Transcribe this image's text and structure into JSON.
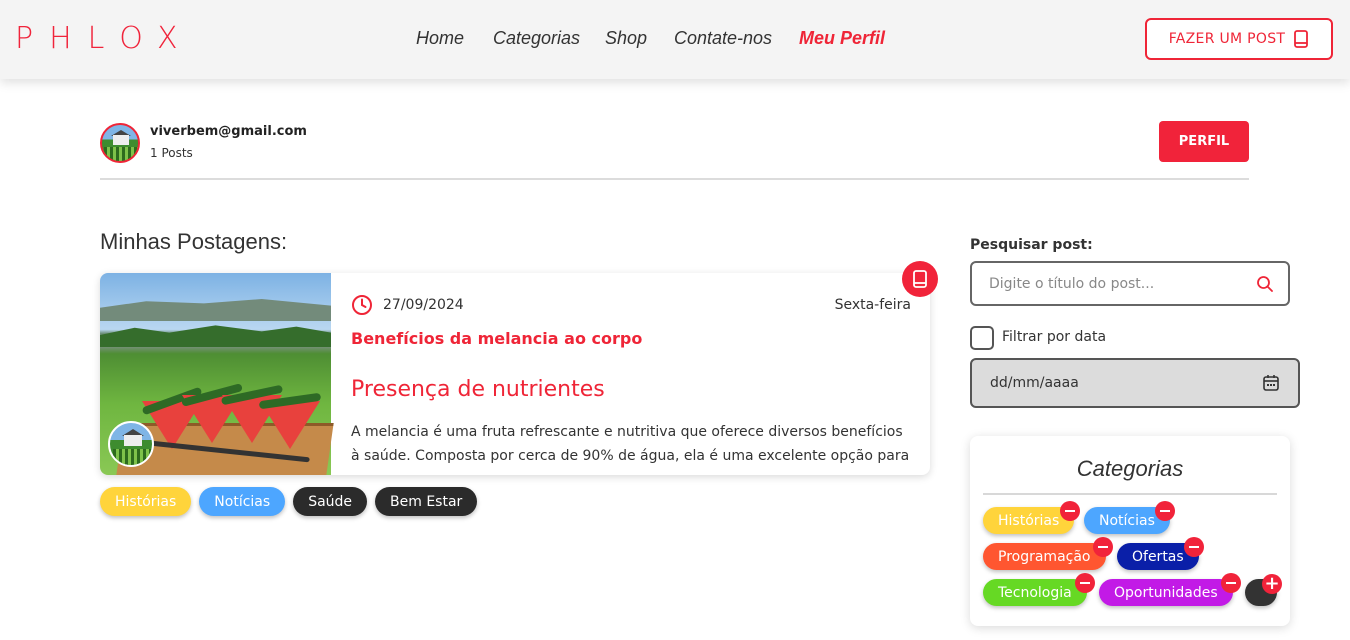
{
  "header": {
    "logo": "PHLOX",
    "nav": [
      "Home",
      "Categorias",
      "Shop",
      "Contate-nos",
      "Meu Perfil"
    ],
    "post_button": "FAZER UM POST"
  },
  "profile": {
    "email": "viverbem@gmail.com",
    "posts_count": "1 Posts",
    "profile_button": "PERFIL"
  },
  "posts": {
    "section_title": "Minhas Postagens:",
    "items": [
      {
        "date": "27/09/2024",
        "weekday": "Sexta-feira",
        "title": "Benefícios da melancia ao corpo",
        "subtitle": "Presença de nutrientes",
        "excerpt": "A melancia é uma fruta refrescante e nutritiva que oferece diversos benefícios à saúde. Composta por cerca de 90% de água, ela é uma excelente opção para",
        "tags": [
          {
            "label": "Histórias",
            "color": "#ffd43b",
            "text": "#ffffff"
          },
          {
            "label": "Notícias",
            "color": "#4da6ff",
            "text": "#ffffff"
          },
          {
            "label": "Saúde",
            "color": "#2b2b2b",
            "text": "#ffffff"
          },
          {
            "label": "Bem Estar",
            "color": "#2b2b2b",
            "text": "#ffffff"
          }
        ]
      }
    ]
  },
  "sidebar": {
    "search_label": "Pesquisar post:",
    "search_placeholder": "Digite o título do post...",
    "filter_label": "Filtrar por data",
    "date_placeholder": "dd/mm/aaaa",
    "categories_title": "Categorias",
    "categories": [
      {
        "label": "Histórias",
        "color": "#ffd43b"
      },
      {
        "label": "Notícias",
        "color": "#4da6ff"
      },
      {
        "label": "Programação",
        "color": "#ff5630"
      },
      {
        "label": "Ofertas",
        "color": "#0a1fa8"
      },
      {
        "label": "Tecnologia",
        "color": "#66d924"
      },
      {
        "label": "Oportunidades",
        "color": "#c21ae6"
      }
    ]
  },
  "colors": {
    "accent": "#ef2537"
  }
}
